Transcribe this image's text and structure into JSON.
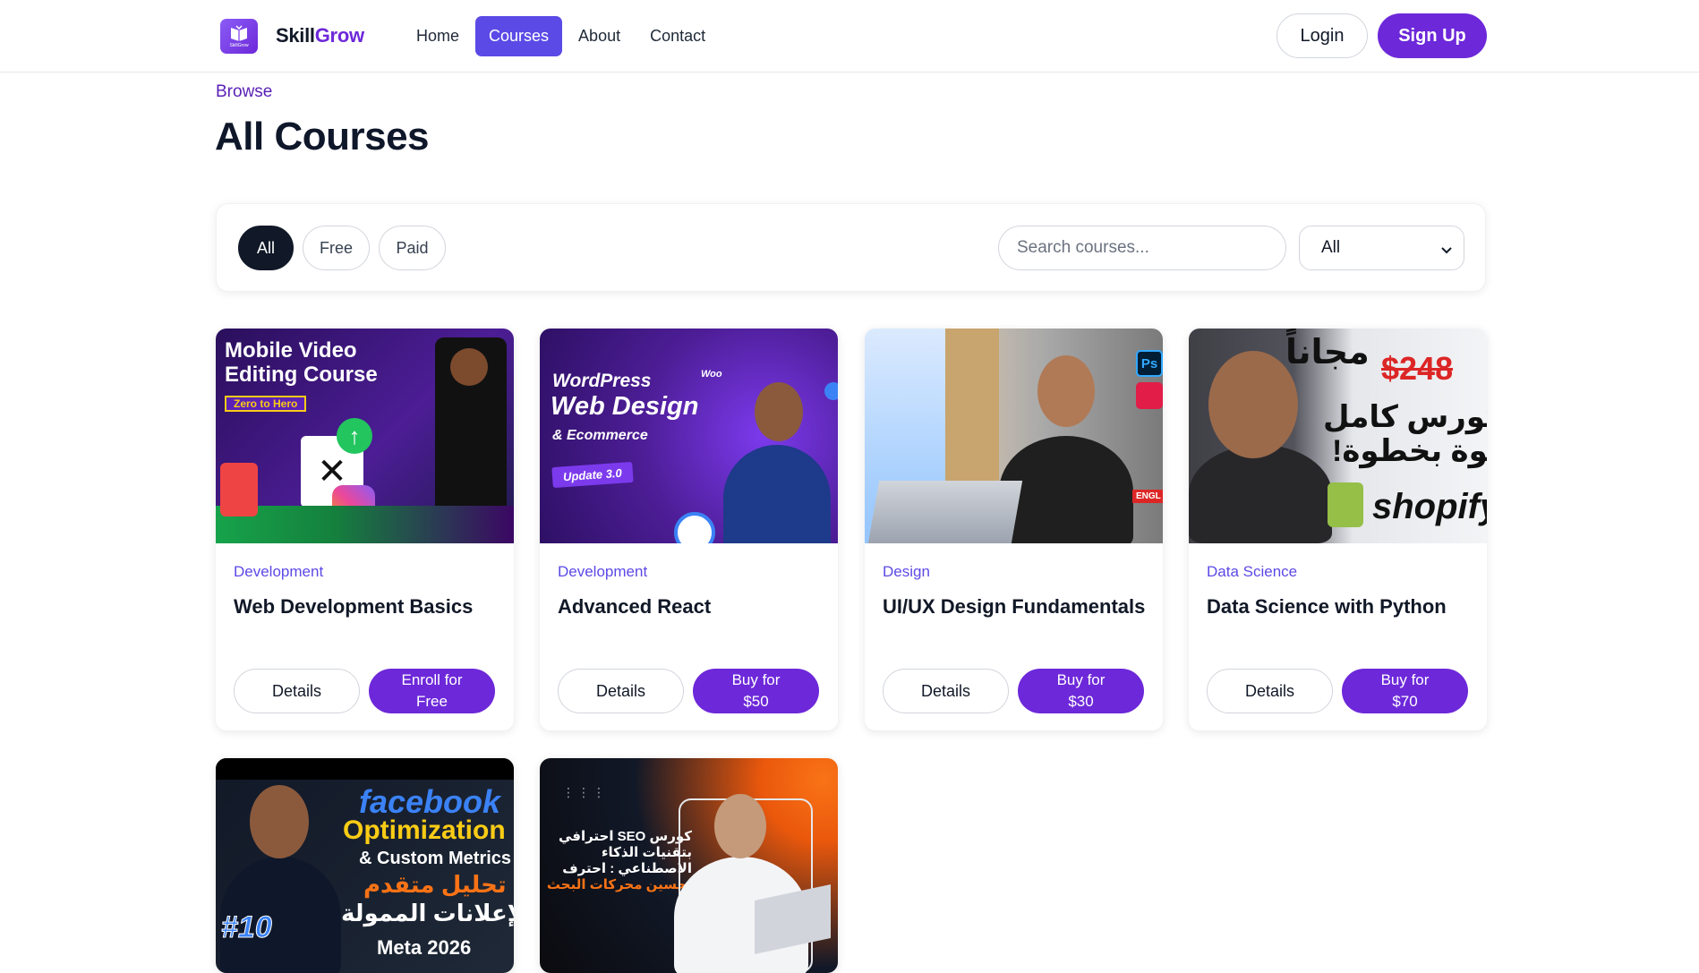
{
  "navbar": {
    "logo_small_text": "SkillGrow",
    "brand_part1": "Skill",
    "brand_part2": "Grow",
    "links": [
      {
        "label": "Home",
        "active": false
      },
      {
        "label": "Courses",
        "active": true
      },
      {
        "label": "About",
        "active": false
      },
      {
        "label": "Contact",
        "active": false
      }
    ],
    "login_label": "Login",
    "signup_label": "Sign Up"
  },
  "header": {
    "eyebrow": "Browse",
    "title": "All Courses"
  },
  "filters": {
    "chips": [
      {
        "label": "All",
        "active": true
      },
      {
        "label": "Free",
        "active": false
      },
      {
        "label": "Paid",
        "active": false
      }
    ],
    "search_placeholder": "Search courses...",
    "category_select_value": "All"
  },
  "courses": [
    {
      "category": "Development",
      "title": "Web Development Basics",
      "details_label": "Details",
      "action_label": "Enroll for Free",
      "thumbnail": {
        "line1": "Mobile Video",
        "line2": "Editing Course",
        "badge": "Zero to Hero"
      }
    },
    {
      "category": "Development",
      "title": "Advanced React",
      "details_label": "Details",
      "action_label": "Buy for $50",
      "thumbnail": {
        "line1": "WordPress",
        "line2": "Web Design",
        "line3": "& Ecommerce",
        "badge": "Update 3.0",
        "tag": "Woo"
      }
    },
    {
      "category": "Design",
      "title": "UI/UX Design Fundamentals",
      "details_label": "Details",
      "action_label": "Buy for $30",
      "thumbnail": {
        "badge": "Ps",
        "corner_tag": "ENGL"
      }
    },
    {
      "category": "Data Science",
      "title": "Data Science with Python",
      "details_label": "Details",
      "action_label": "Buy for $70",
      "thumbnail": {
        "free_word": "مجاناً",
        "old_price": "$248",
        "line1": "كورس كامل",
        "line2": "خطوة بخطوة!",
        "brand": "shopify"
      }
    },
    {
      "thumbnail": {
        "line1": "facebook",
        "line2": "Optimization",
        "line3": "& Custom Metrics",
        "line4": "تحليل متقدم",
        "line5": "للإعلانات الممولة",
        "badge": "#10",
        "footer": "Meta 2026"
      }
    },
    {
      "thumbnail": {
        "line1": "كورس SEO احترافي",
        "line2": "بتقنيات الذكاء",
        "line3": "الاصطناعي : احترف",
        "line4": "تحسين محركات البحث"
      }
    }
  ],
  "colors": {
    "brand_purple": "#6d28d9",
    "nav_active": "#5b4ae6",
    "dark_chip": "#111827"
  }
}
